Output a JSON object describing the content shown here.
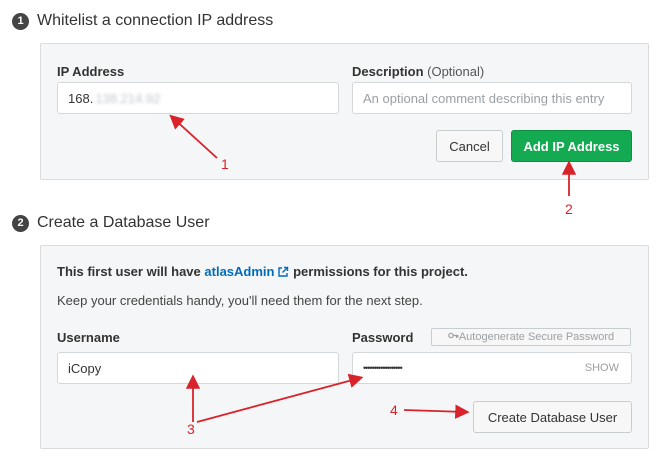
{
  "step1": {
    "number": "1",
    "title": "Whitelist a connection IP address",
    "ip_label": "IP Address",
    "ip_value_prefix": "168.",
    "ip_value_blurred": "138.214.92",
    "desc_label": "Description",
    "desc_optional": "(Optional)",
    "desc_placeholder": "An optional comment describing this entry",
    "cancel_label": "Cancel",
    "add_label": "Add IP Address"
  },
  "step2": {
    "number": "2",
    "title": "Create a Database User",
    "info_prefix": "This first user will have",
    "info_link": "atlasAdmin",
    "info_suffix": "permissions for this project.",
    "info_note": "Keep your credentials handy, you'll need them for the next step.",
    "username_label": "Username",
    "username_value": "iCopy",
    "password_label": "Password",
    "autogen_label": "Autogenerate Secure Password",
    "password_mask": "••••••••••••••••••",
    "show_label": "SHOW",
    "create_label": "Create Database User"
  },
  "annotations": {
    "a1": "1",
    "a2": "2",
    "a3": "3",
    "a4": "4",
    "color": "#d8232a"
  },
  "colors": {
    "primary_green": "#13aa52",
    "link_blue": "#006cbc",
    "panel_bg": "#f5f6f7"
  },
  "icons": {
    "external_link": "external-link-icon",
    "key": "key-icon"
  }
}
